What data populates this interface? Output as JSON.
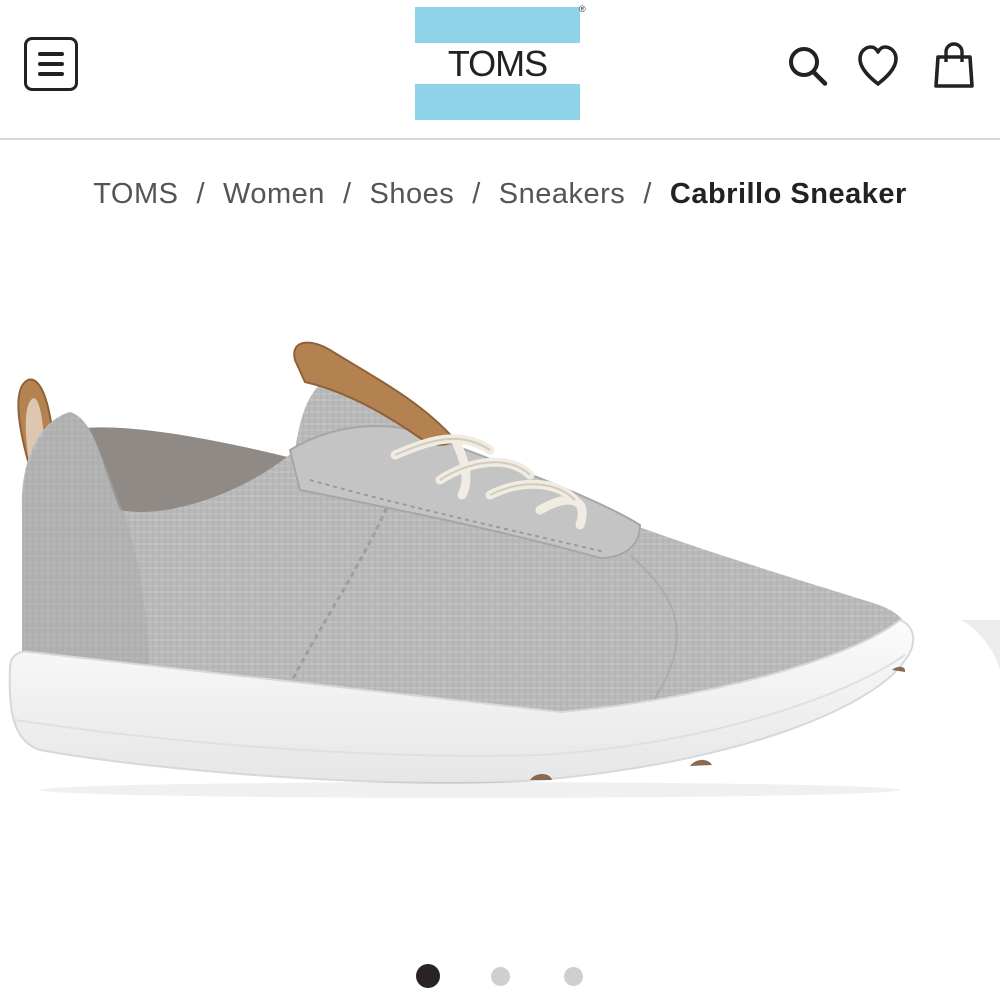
{
  "header": {
    "menu_icon": "hamburger-menu-icon",
    "logo_text": "TOMS",
    "logo_registered": "®",
    "logo_colors": {
      "band": "#8fd3e8",
      "text": "#222222"
    },
    "actions": [
      {
        "name": "search",
        "icon": "search-icon"
      },
      {
        "name": "wishlist",
        "icon": "heart-icon"
      },
      {
        "name": "bag",
        "icon": "shopping-bag-icon"
      }
    ]
  },
  "breadcrumb": {
    "items": [
      "TOMS",
      "Women",
      "Shoes",
      "Sneakers"
    ],
    "separator": "/",
    "current": "Cabrillo Sneaker"
  },
  "gallery": {
    "image_subject": "product-image",
    "slide_count": 3,
    "active_slide": 1,
    "colors": {
      "active": "#2a2323",
      "inactive": "#cfcfcf"
    }
  }
}
